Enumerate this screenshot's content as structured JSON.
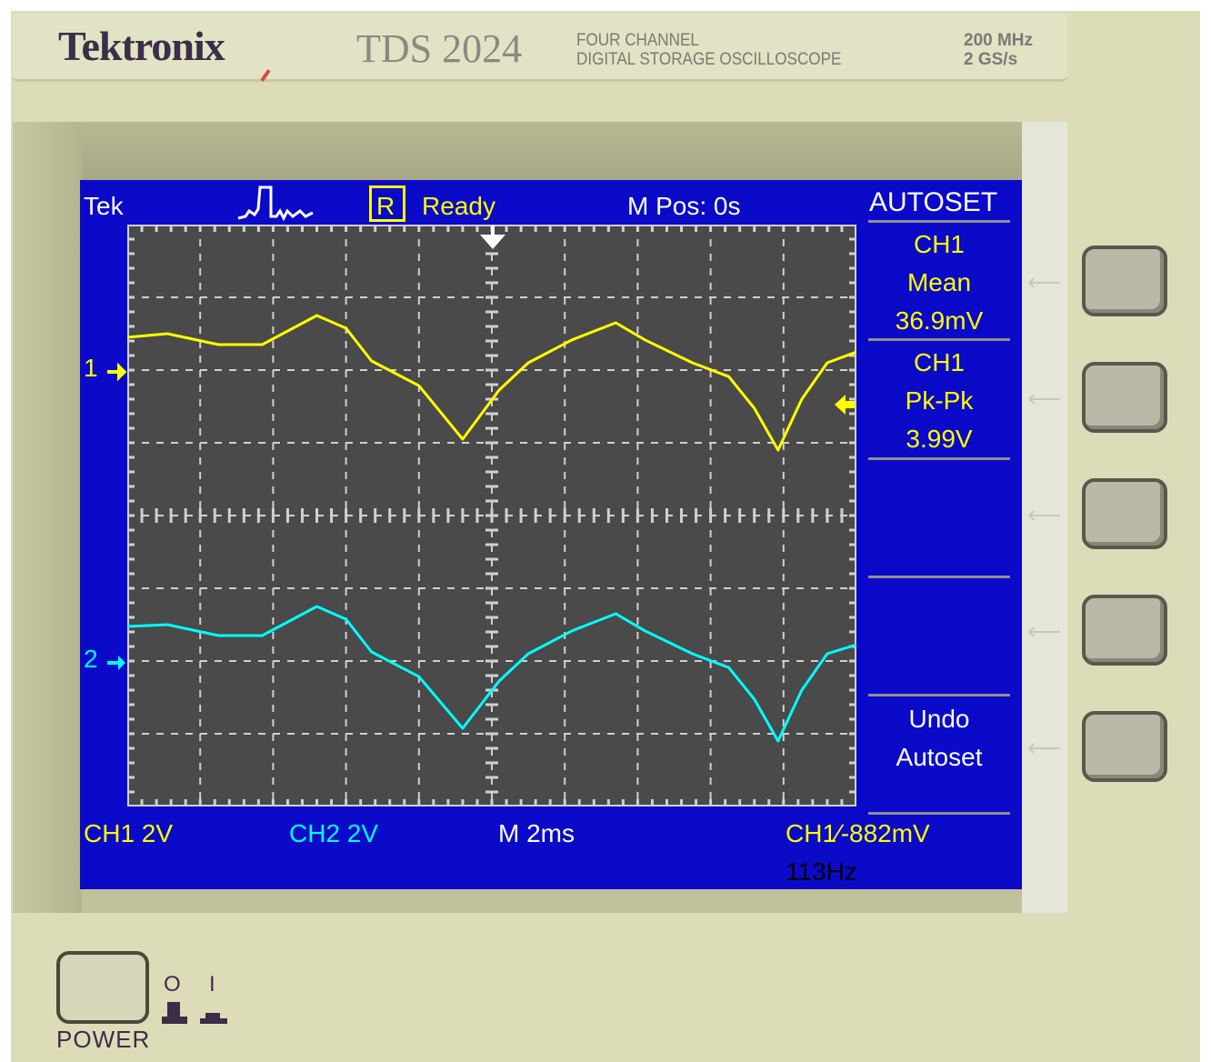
{
  "brand": {
    "logo": "Tektronix",
    "model": "TDS 2024",
    "desc_line1": "FOUR CHANNEL",
    "desc_line2": "DIGITAL STORAGE OSCILLOSCOPE",
    "spec_line1": "200 MHz",
    "spec_line2": "2 GS/s"
  },
  "status": {
    "brand": "Tek",
    "run_indicator": "R",
    "state": "Ready",
    "mpos": "M Pos: 0s"
  },
  "menu": {
    "title": "AUTOSET",
    "items": [
      {
        "line1": "CH1",
        "line2": "Mean",
        "line3": "36.9mV"
      },
      {
        "line1": "CH1",
        "line2": "Pk-Pk",
        "line3": "3.99V"
      },
      {
        "line1": "",
        "line2": "",
        "line3": ""
      },
      {
        "line1": "",
        "line2": "",
        "line3": ""
      },
      {
        "line1": "Undo",
        "line2": "Autoset",
        "line3": ""
      }
    ]
  },
  "footer": {
    "ch1": "CH1  2V",
    "ch2": "CH2  2V",
    "timebase": "M 2ms",
    "trigger": "CH1∕-882mV",
    "freq": "113Hz"
  },
  "markers": {
    "ch1": "1",
    "ch2": "2"
  },
  "power": {
    "label": "POWER",
    "off": "O",
    "on": "I"
  },
  "colors": {
    "ch1": "#ffff00",
    "ch2": "#00ffff",
    "screen": "#0a0ac8"
  },
  "chart_data": {
    "type": "line",
    "x_unit": "ms",
    "y_unit": "V",
    "xlim": [
      -10,
      10
    ],
    "ylim": [
      -8,
      8
    ],
    "x_divisions": 10,
    "y_divisions": 8,
    "grid": true,
    "series": [
      {
        "name": "CH1",
        "volts_per_div": 2,
        "ground_div": 2,
        "t": [
          -10,
          -8.9,
          -7.5,
          -6.3,
          -4.8,
          -4.0,
          -3.3,
          -2.0,
          -0.8,
          0.2,
          1.0,
          2.2,
          3.4,
          4.2,
          5.5,
          6.5,
          7.2,
          7.85,
          8.5,
          9.2,
          10
        ],
        "v": [
          0.9,
          1.0,
          0.7,
          0.7,
          1.5,
          1.15,
          0.25,
          -0.43,
          -1.9,
          -0.55,
          0.2,
          0.83,
          1.3,
          0.83,
          0.2,
          -0.18,
          -1.05,
          -2.2,
          -0.8,
          0.2,
          0.5
        ]
      },
      {
        "name": "CH2",
        "volts_per_div": 2,
        "ground_div": -2,
        "t": [
          -10,
          -8.9,
          -7.5,
          -6.3,
          -4.8,
          -4.0,
          -3.3,
          -2.0,
          -0.8,
          0.2,
          1.0,
          2.2,
          3.4,
          4.2,
          5.5,
          6.5,
          7.2,
          7.85,
          8.5,
          9.2,
          10
        ],
        "v": [
          0.95,
          1.0,
          0.7,
          0.7,
          1.5,
          1.15,
          0.25,
          -0.43,
          -1.85,
          -0.55,
          0.2,
          0.83,
          1.3,
          0.83,
          0.2,
          -0.18,
          -1.05,
          -2.2,
          -0.8,
          0.2,
          0.45
        ]
      }
    ]
  }
}
